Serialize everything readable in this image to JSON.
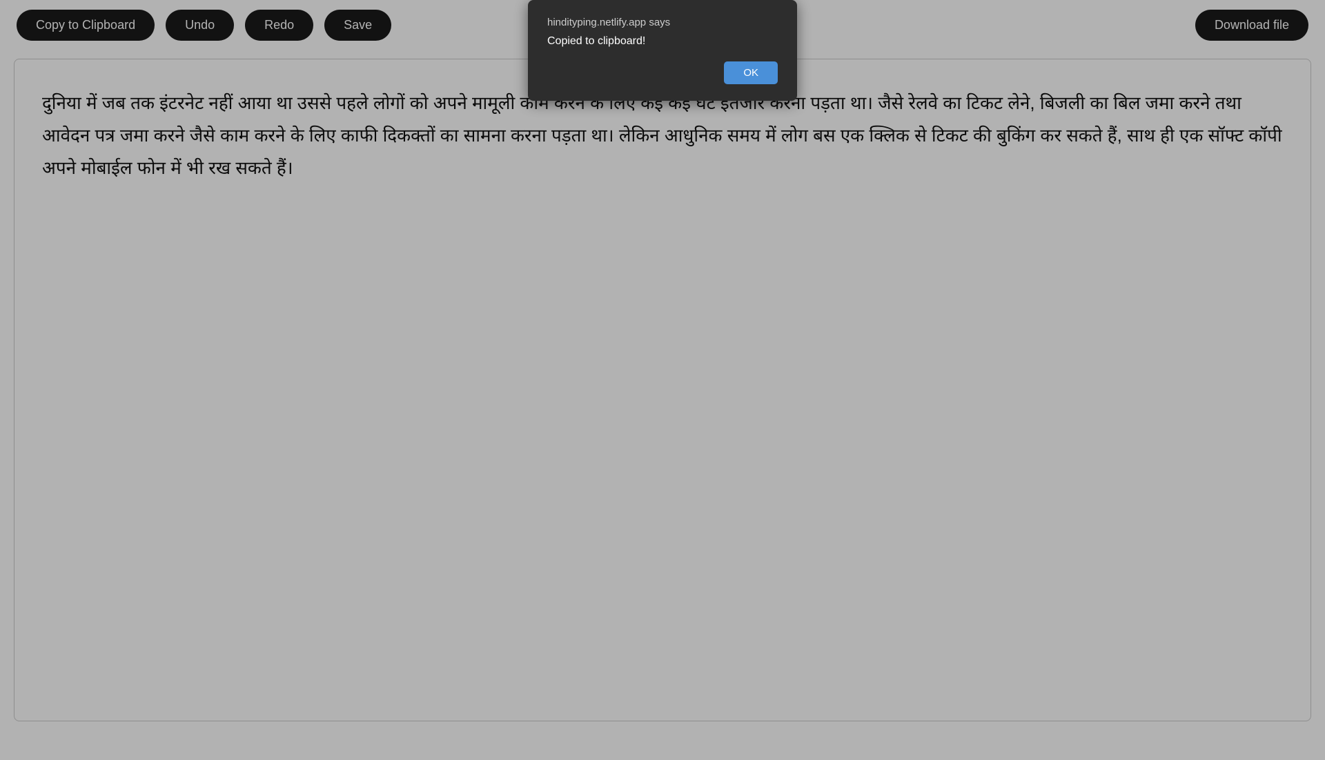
{
  "toolbar": {
    "copy_label": "Copy to Clipboard",
    "undo_label": "Undo",
    "redo_label": "Redo",
    "save_label": "Save",
    "download_label": "Download file"
  },
  "dialog": {
    "title": "hindityping.netlify.app says",
    "message": "Copied to clipboard!",
    "ok_label": "OK"
  },
  "content": {
    "text": "दुनिया में जब तक इंटरनेट नहीं आया था उससे पहले लोगों को अपने मामूली काम करने के लिए कई कई घंटे इंतजार करना पड़ता था।  जैसे रेलवे का टिकट लेने, बिजली का बिल जमा करने तथा आवेदन पत्र जमा करने जैसे काम करने के लिए काफी दिकक्तों का सामना करना पड़ता था।  लेकिन आधुनिक समय में लोग बस एक क्लिक से टिकट की बुकिंग कर सकते हैं, साथ ही एक सॉफ्ट कॉपी अपने मोबाईल फोन में भी रख सकते हैं।"
  }
}
